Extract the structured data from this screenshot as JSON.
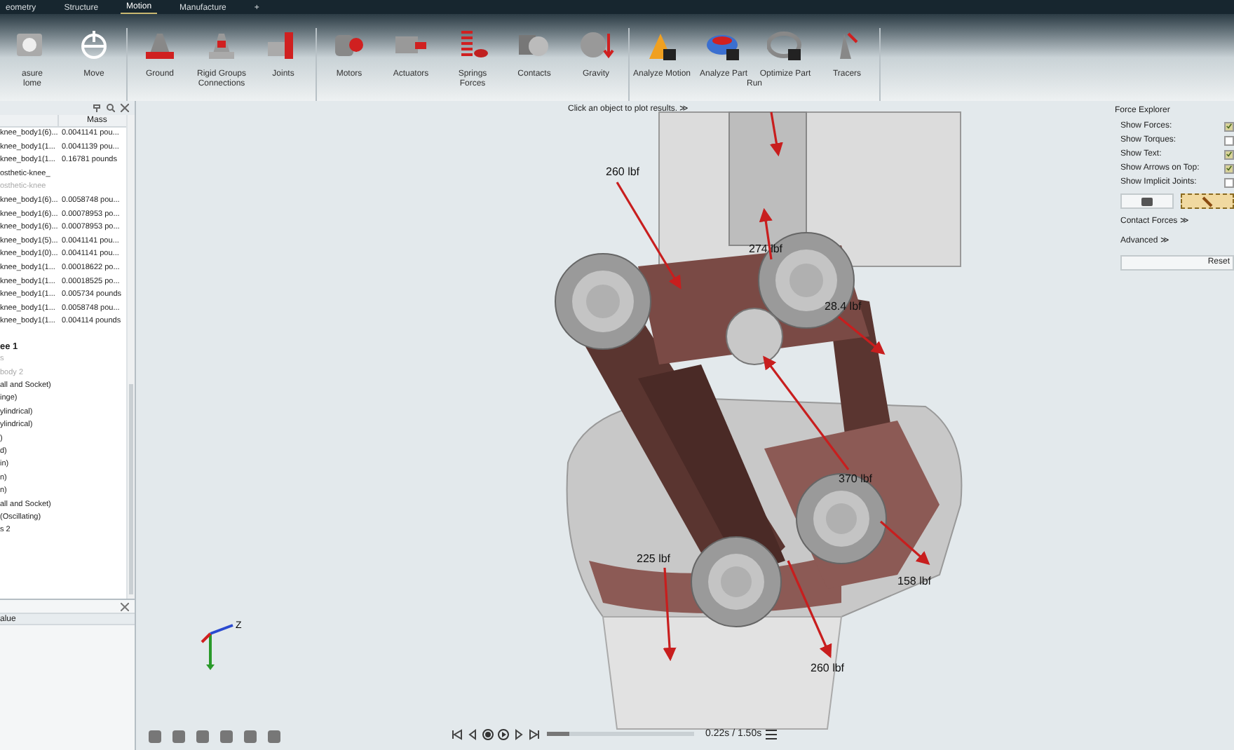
{
  "tabs": [
    {
      "label": "eometry",
      "selected": false
    },
    {
      "label": "Structure",
      "selected": false
    },
    {
      "label": "Motion",
      "selected": true
    },
    {
      "label": "Manufacture",
      "selected": false
    },
    {
      "label": "+",
      "selected": false
    }
  ],
  "ribbon": {
    "groups": [
      {
        "tools": [
          {
            "label": "asure",
            "label2": "lome"
          },
          {
            "label": "Move"
          }
        ]
      },
      {
        "label": "Connections",
        "tools": [
          {
            "label": "Ground"
          },
          {
            "label": "Rigid Groups"
          },
          {
            "label": "Joints"
          }
        ]
      },
      {
        "label": "Forces",
        "tools": [
          {
            "label": "Motors"
          },
          {
            "label": "Actuators"
          },
          {
            "label": "Springs"
          },
          {
            "label": "Contacts"
          },
          {
            "label": "Gravity"
          }
        ]
      },
      {
        "label": "Run",
        "tools": [
          {
            "label": "Analyze Motion"
          },
          {
            "label": "Analyze Part"
          },
          {
            "label": "Optimize Part"
          },
          {
            "label": "Tracers"
          }
        ]
      }
    ]
  },
  "browser": {
    "column_header": "Mass",
    "rows": [
      {
        "name": "knee_body1(6)...",
        "mass": "0.0041141 pou..."
      },
      {
        "name": "knee_body1(1...",
        "mass": "0.0041139 pou..."
      },
      {
        "name": "knee_body1(1...",
        "mass": "0.16781 pounds"
      },
      {
        "name": "osthetic-knee_",
        "mass": ""
      },
      {
        "name": "osthetic-knee",
        "mass": "",
        "disabled": true
      },
      {
        "name": "knee_body1(6)...",
        "mass": "0.0058748 pou..."
      },
      {
        "name": "knee_body1(6)...",
        "mass": "0.00078953 po..."
      },
      {
        "name": "knee_body1(6)...",
        "mass": "0.00078953 po..."
      },
      {
        "name": "knee_body1(5)...",
        "mass": "0.0041141 pou..."
      },
      {
        "name": "knee_body1(0)...",
        "mass": "0.0041141 pou..."
      },
      {
        "name": "knee_body1(1...",
        "mass": "0.00018622 po..."
      },
      {
        "name": "knee_body1(1...",
        "mass": "0.00018525 po..."
      },
      {
        "name": "knee_body1(1...",
        "mass": "0.005734 pounds"
      },
      {
        "name": "knee_body1(1...",
        "mass": "0.0058748 pou..."
      },
      {
        "name": "knee_body1(1...",
        "mass": "0.004114 pounds"
      }
    ],
    "tree": [
      {
        "label": "ee 1",
        "bold": true
      },
      {
        "label": "s",
        "disabled": true
      },
      {
        "label": "body 2",
        "disabled": true
      },
      {
        "label": "all and Socket)"
      },
      {
        "label": "inge)"
      },
      {
        "label": "ylindrical)"
      },
      {
        "label": "ylindrical)"
      },
      {
        "label": ")"
      },
      {
        "label": "d)"
      },
      {
        "label": "in)"
      },
      {
        "label": "n)"
      },
      {
        "label": "n)"
      },
      {
        "label": "all and Socket)"
      },
      {
        "label": "(Oscillating)"
      },
      {
        "label": "s 2"
      }
    ]
  },
  "properties": {
    "column_header": "alue"
  },
  "viewport": {
    "hint": "Click an object to plot results. ≫",
    "axis_label": "Z",
    "force_labels": [
      "260 lbf",
      "274 lbf",
      "28.4 lbf",
      "370 lbf",
      "158 lbf",
      "225 lbf",
      "260 lbf"
    ]
  },
  "force_explorer": {
    "title": "Force Explorer",
    "options": [
      {
        "label": "Show Forces:",
        "checked": true
      },
      {
        "label": "Show Torques:",
        "checked": false
      },
      {
        "label": "Show Text:",
        "checked": true
      },
      {
        "label": "Show Arrows on Top:",
        "checked": true
      },
      {
        "label": "Show Implicit Joints:",
        "checked": false
      }
    ],
    "mode_buttons": [
      {
        "selected": false
      },
      {
        "selected": true
      }
    ],
    "sections": [
      "Contact Forces ≫",
      "Advanced ≫"
    ],
    "reset": "Reset"
  },
  "playback": {
    "level": 0.15,
    "time": "0.22s / 1.50s"
  }
}
